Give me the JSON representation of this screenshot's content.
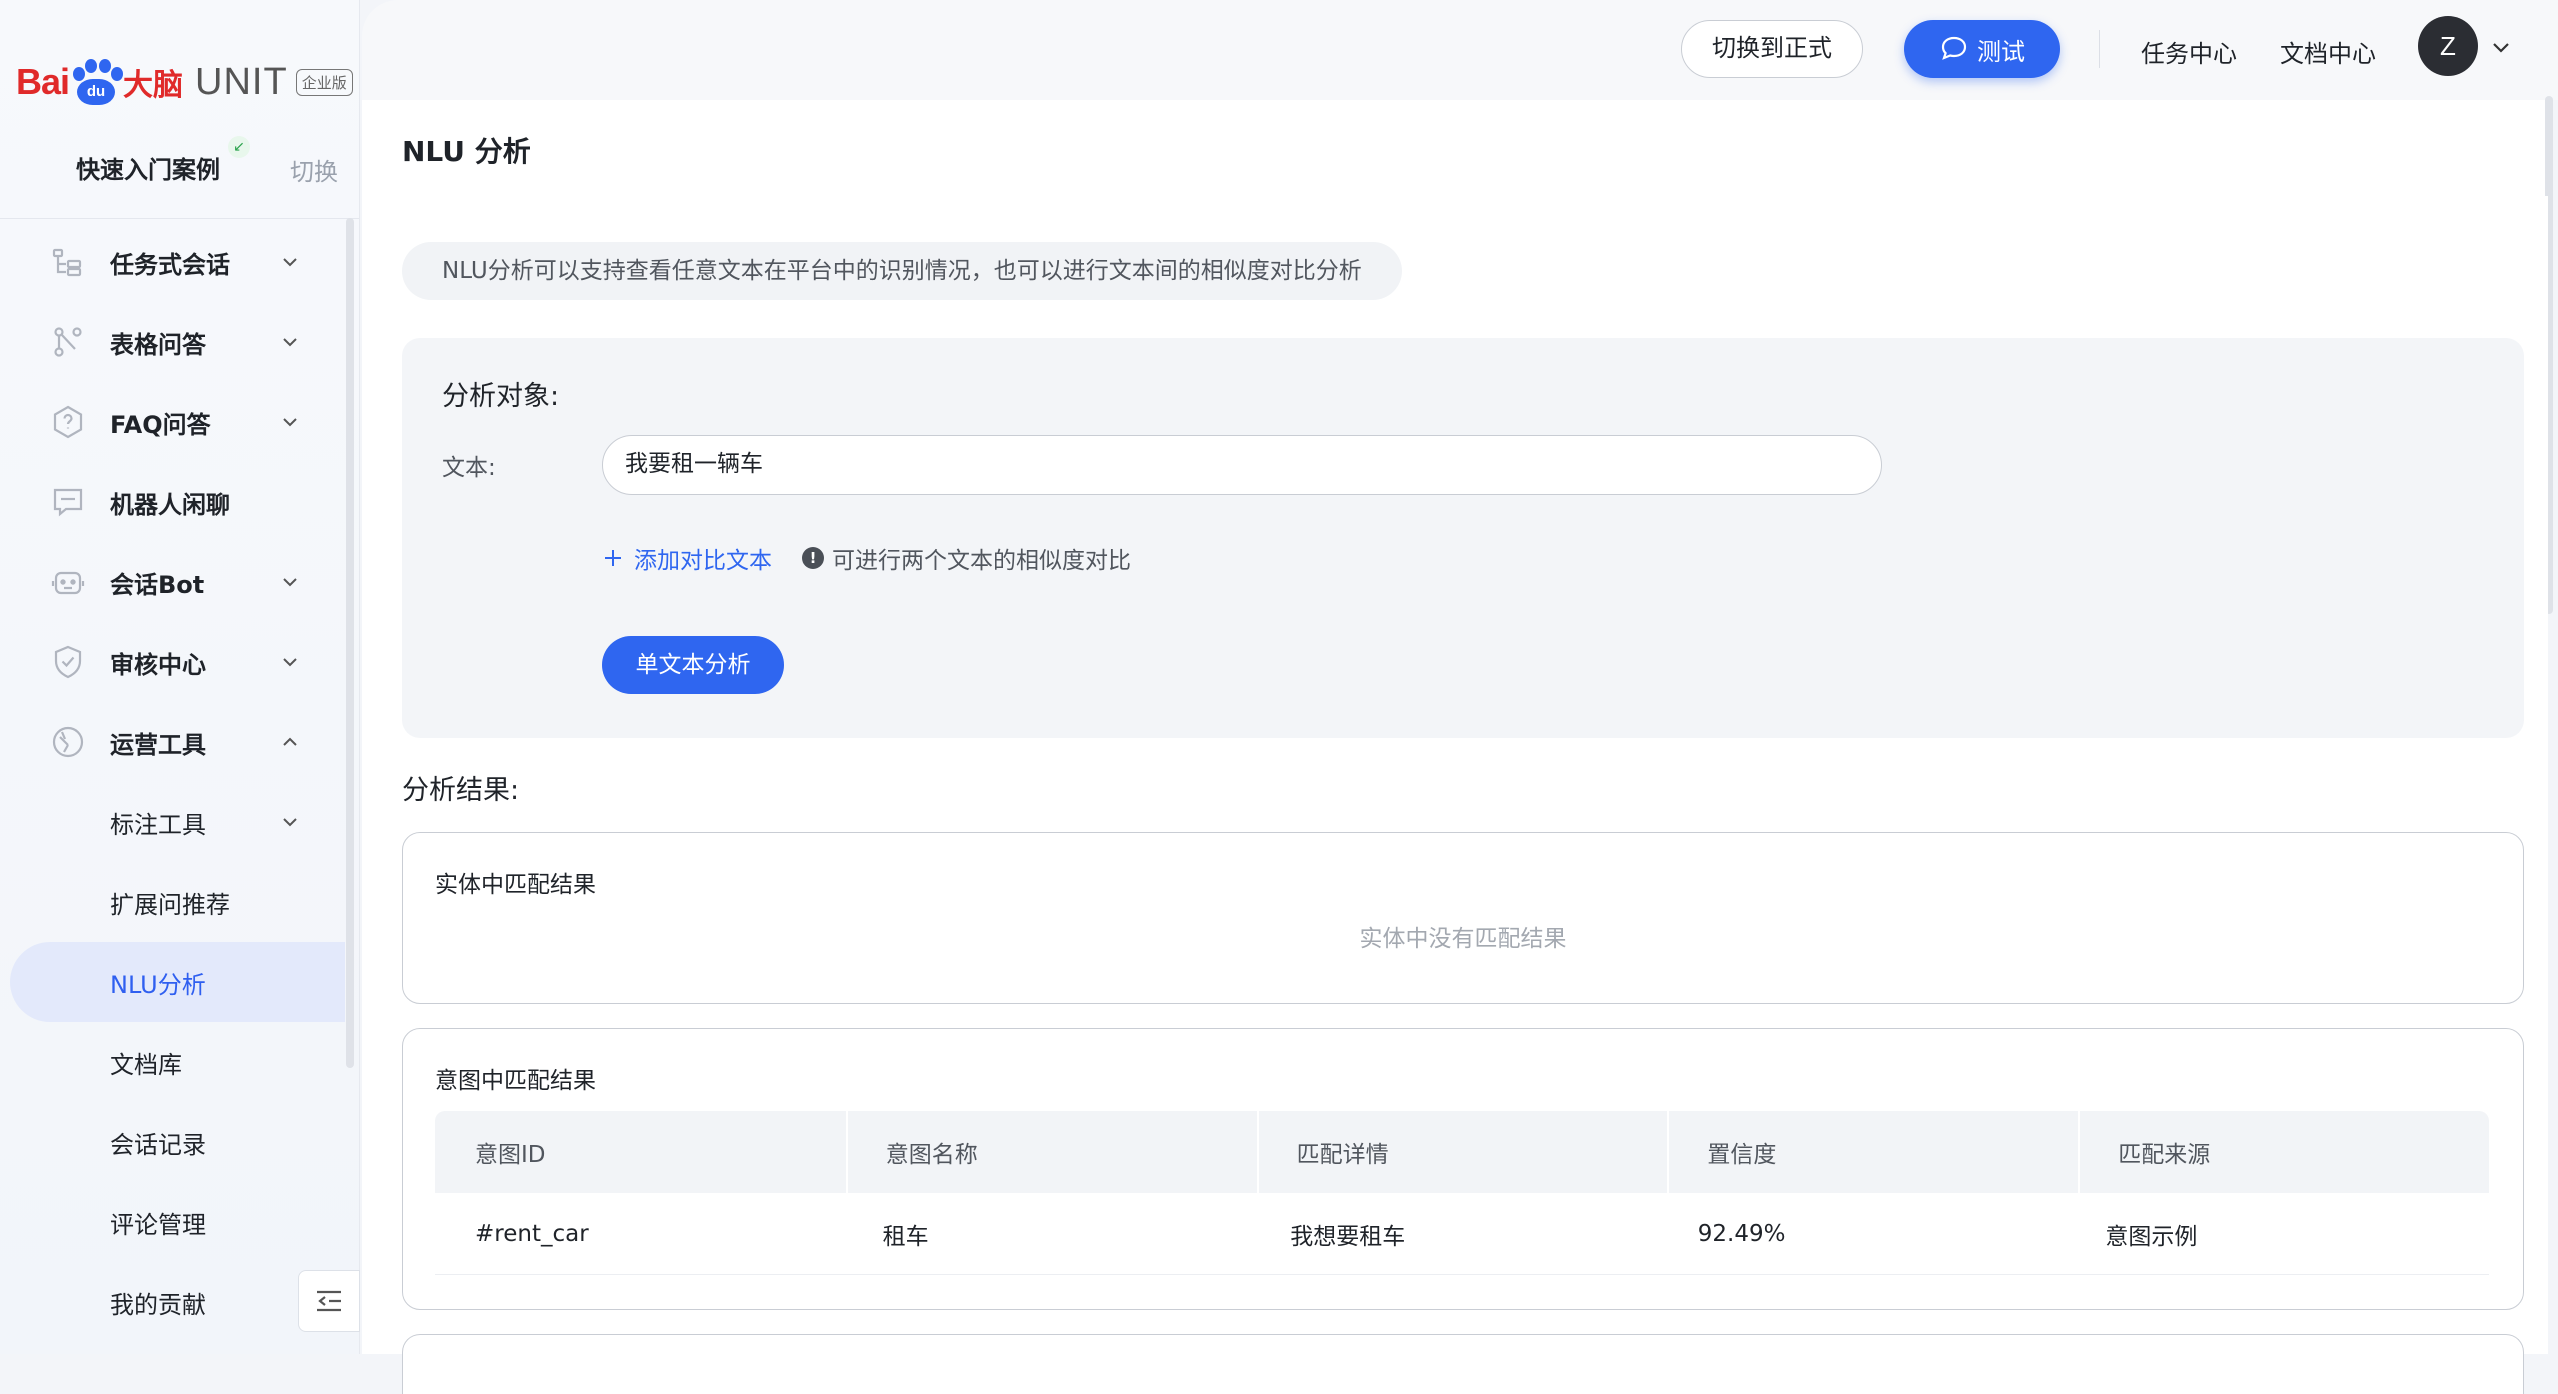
{
  "brand": {
    "bai": "Bai",
    "du": "du",
    "name_cn": "大脑",
    "unit": "UNIT",
    "edition": "企业版"
  },
  "sidebar": {
    "case_label": "快速入门案例",
    "switch_label": "切换",
    "items": [
      {
        "label": "任务式会话",
        "icon": "task-dialog-icon",
        "expanded": false
      },
      {
        "label": "表格问答",
        "icon": "table-qa-icon",
        "expanded": false
      },
      {
        "label": "FAQ问答",
        "icon": "faq-icon",
        "expanded": false
      },
      {
        "label": "机器人闲聊",
        "icon": "chat-icon"
      },
      {
        "label": "会话Bot",
        "icon": "bot-icon",
        "expanded": false
      },
      {
        "label": "审核中心",
        "icon": "shield-icon",
        "expanded": false
      },
      {
        "label": "运营工具",
        "icon": "tools-icon",
        "expanded": true
      }
    ],
    "sub_items": [
      {
        "label": "标注工具",
        "has_children": true
      },
      {
        "label": "扩展问推荐"
      },
      {
        "label": "NLU分析",
        "active": true
      },
      {
        "label": "文档库"
      },
      {
        "label": "会话记录"
      },
      {
        "label": "评论管理"
      },
      {
        "label": "我的贡献"
      }
    ]
  },
  "header": {
    "switch_formal": "切换到正式",
    "test": "测试",
    "task_center": "任务中心",
    "doc_center": "文档中心",
    "avatar_letter": "Z"
  },
  "page": {
    "title": "NLU 分析",
    "tip": "NLU分析可以支持查看任意文本在平台中的识别情况，也可以进行文本间的相似度对比分析"
  },
  "analysis": {
    "title": "分析对象:",
    "text_label": "文本:",
    "text_value": "我要租一辆车",
    "add_compare": "添加对比文本",
    "hint": "可进行两个文本的相似度对比",
    "button": "单文本分析"
  },
  "results": {
    "title": "分析结果:",
    "entity_card": {
      "title": "实体中匹配结果",
      "empty": "实体中没有匹配结果"
    },
    "intent_card": {
      "title": "意图中匹配结果",
      "columns": [
        "意图ID",
        "意图名称",
        "匹配详情",
        "置信度",
        "匹配来源"
      ],
      "rows": [
        [
          "#rent_car",
          "租车",
          "我想要租车",
          "92.49%",
          "意图示例"
        ]
      ]
    }
  },
  "colors": {
    "accent": "#2f66f0",
    "brand_red": "#e02a2a",
    "active_bg": "#e3e9fb"
  }
}
